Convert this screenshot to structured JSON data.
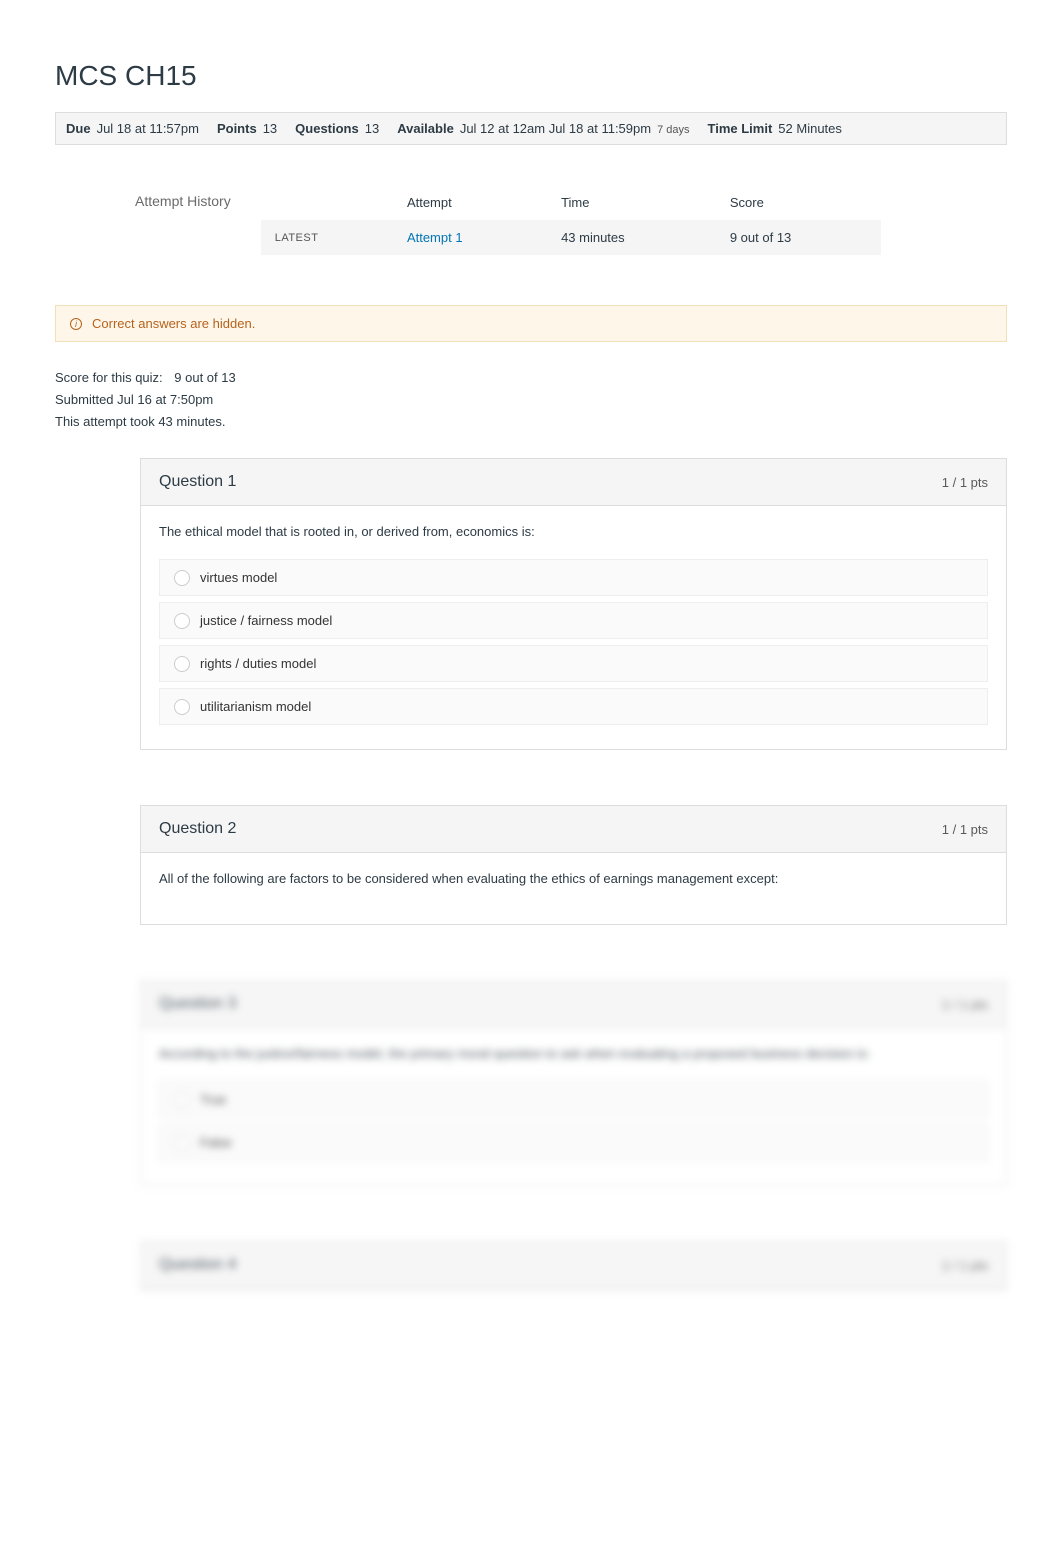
{
  "title": "MCS CH15",
  "meta": {
    "due_label": "Due",
    "due_value": "Jul 18 at 11:57pm",
    "points_label": "Points",
    "points_value": "13",
    "questions_label": "Questions",
    "questions_value": "13",
    "available_label": "Available",
    "available_value": "Jul 12 at 12am Jul 18 at 11:59pm",
    "available_sub": "7 days",
    "timelimit_label": "Time Limit",
    "timelimit_value": "52 Minutes"
  },
  "attempt_history": {
    "label": "Attempt History",
    "headers": {
      "attempt": "Attempt",
      "time": "Time",
      "score": "Score"
    },
    "row": {
      "latest": "LATEST",
      "attempt": "Attempt 1",
      "time": "43 minutes",
      "score": "9 out of 13"
    }
  },
  "alert": {
    "text": "Correct answers are hidden."
  },
  "summary": {
    "score_label": "Score for this quiz:",
    "score_value": "9 out of 13",
    "submitted": "Submitted Jul 16 at 7:50pm",
    "took": "This attempt took 43 minutes."
  },
  "questions": [
    {
      "label": "Question 1",
      "pts": "1 / 1 pts",
      "prompt": "The ethical model that is rooted in, or derived from, economics is:",
      "answers": [
        "virtues model",
        "justice / fairness model",
        "rights / duties model",
        "utilitarianism model"
      ],
      "locked": false
    },
    {
      "label": "Question 2",
      "pts": "1 / 1 pts",
      "prompt": "All of the following are factors to be considered when evaluating the ethics of earnings management except:",
      "answers": [],
      "locked": false
    },
    {
      "label": "Question 3",
      "pts": "1 / 1 pts",
      "prompt": "According to the justice/fairness model, the primary moral question to ask when evaluating a proposed business decision is:",
      "answers": [
        "True",
        "False"
      ],
      "locked": true
    },
    {
      "label": "Question 4",
      "pts": "1 / 1 pts",
      "prompt": "",
      "answers": [],
      "locked": true,
      "header_only": true
    }
  ]
}
